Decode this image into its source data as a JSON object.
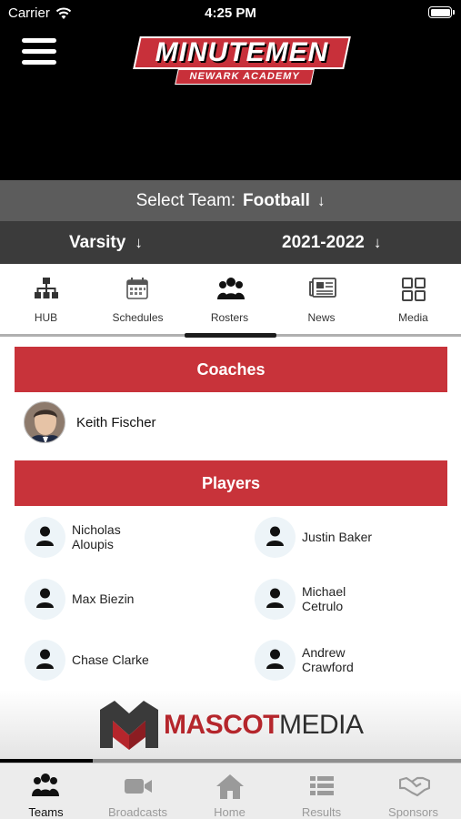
{
  "status_bar": {
    "carrier": "Carrier",
    "time": "4:25 PM"
  },
  "header": {
    "logo_title": "MINUTEMEN",
    "logo_subtitle": "NEWARK ACADEMY"
  },
  "team_select": {
    "label": "Select Team:",
    "value": "Football"
  },
  "filters": {
    "level": "Varsity",
    "season": "2021-2022"
  },
  "tabs": [
    {
      "label": "HUB",
      "icon": "hierarchy-icon"
    },
    {
      "label": "Schedules",
      "icon": "calendar-icon"
    },
    {
      "label": "Rosters",
      "icon": "people-icon",
      "active": true
    },
    {
      "label": "News",
      "icon": "newspaper-icon"
    },
    {
      "label": "Media",
      "icon": "grid-icon"
    }
  ],
  "coaches": {
    "heading": "Coaches",
    "items": [
      {
        "name": "Keith Fischer"
      }
    ]
  },
  "players": {
    "heading": "Players",
    "items": [
      {
        "name": "Nicholas\nAloupis"
      },
      {
        "name": "Justin Baker"
      },
      {
        "name": "Max Biezin"
      },
      {
        "name": "Michael\nCetrulo"
      },
      {
        "name": "Chase Clarke"
      },
      {
        "name": "Andrew\nCrawford"
      }
    ]
  },
  "sponsor": {
    "brand_part1": "MASCOT",
    "brand_part2": "MEDIA",
    "colors": {
      "red": "#b5262c",
      "dark": "#2f2f2f"
    }
  },
  "bottom_nav": [
    {
      "label": "Teams",
      "icon": "people-icon",
      "active": true
    },
    {
      "label": "Broadcasts",
      "icon": "video-camera-icon"
    },
    {
      "label": "Home",
      "icon": "home-icon"
    },
    {
      "label": "Results",
      "icon": "list-icon"
    },
    {
      "label": "Sponsors",
      "icon": "handshake-icon"
    }
  ],
  "colors": {
    "accent": "#c8333a",
    "header_bg": "#000000",
    "team_bar": "#5c5c5c",
    "filter_bar": "#3b3b3b"
  }
}
